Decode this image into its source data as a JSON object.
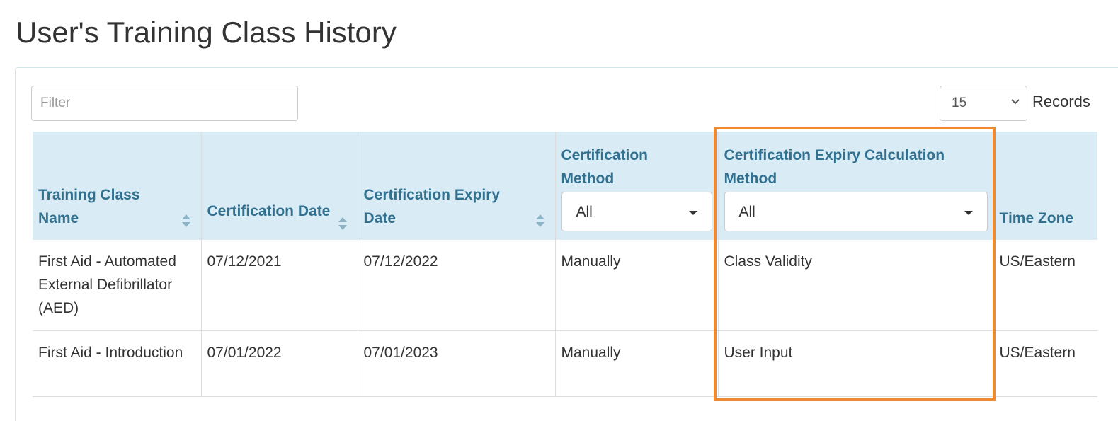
{
  "page": {
    "title": "User's Training Class History"
  },
  "toolbar": {
    "filter_placeholder": "Filter",
    "records_value": "15",
    "records_label": "Records"
  },
  "table": {
    "headers": {
      "training_class_name": "Training Class Name",
      "certification_date": "Certification Date",
      "certification_expiry_date": "Certification Expiry Date",
      "certification_method": "Certification Method",
      "expiry_calculation_method": "Certification Expiry Calculation Method",
      "time_zone": "Time Zone"
    },
    "filters": {
      "certification_method": "All",
      "expiry_calculation_method": "All"
    },
    "rows": [
      {
        "training_class_name": "First Aid - Automated External Defibrillator (AED)",
        "certification_date": "07/12/2021",
        "certification_expiry_date": "07/12/2022",
        "certification_method": "Manually",
        "expiry_calculation_method": "Class Validity",
        "time_zone": "US/Eastern"
      },
      {
        "training_class_name": "First Aid - Introduction",
        "certification_date": "07/01/2022",
        "certification_expiry_date": "07/01/2023",
        "certification_method": "Manually",
        "expiry_calculation_method": "User Input",
        "time_zone": "US/Eastern"
      }
    ]
  },
  "colors": {
    "header_bg": "#d9ecf5",
    "header_text": "#31708f",
    "highlight": "#ee8a31"
  }
}
